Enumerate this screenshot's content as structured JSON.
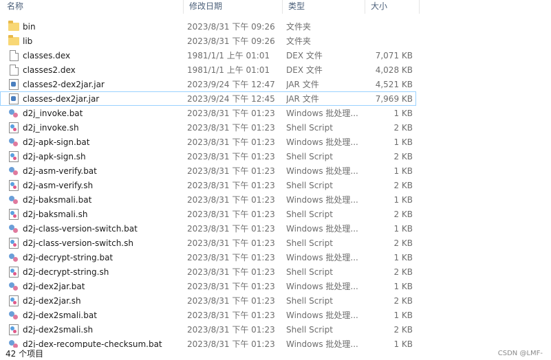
{
  "columns": {
    "name": "名称",
    "date": "修改日期",
    "type": "类型",
    "size": "大小"
  },
  "files": [
    {
      "icon": "folder",
      "name": "bin",
      "date": "2023/8/31 下午 09:26",
      "type": "文件夹",
      "size": ""
    },
    {
      "icon": "folder",
      "name": "lib",
      "date": "2023/8/31 下午 09:26",
      "type": "文件夹",
      "size": ""
    },
    {
      "icon": "file",
      "name": "classes.dex",
      "date": "1981/1/1 上午 01:01",
      "type": "DEX 文件",
      "size": "7,071 KB"
    },
    {
      "icon": "file",
      "name": "classes2.dex",
      "date": "1981/1/1 上午 01:01",
      "type": "DEX 文件",
      "size": "4,028 KB"
    },
    {
      "icon": "jar",
      "name": "classes2-dex2jar.jar",
      "date": "2023/9/24 下午 12:47",
      "type": "JAR 文件",
      "size": "4,521 KB"
    },
    {
      "icon": "jar",
      "name": "classes-dex2jar.jar",
      "date": "2023/9/24 下午 12:45",
      "type": "JAR 文件",
      "size": "7,969 KB",
      "selected": true
    },
    {
      "icon": "gear",
      "name": "d2j_invoke.bat",
      "date": "2023/8/31 下午 01:23",
      "type": "Windows 批处理...",
      "size": "1 KB"
    },
    {
      "icon": "script",
      "name": "d2j_invoke.sh",
      "date": "2023/8/31 下午 01:23",
      "type": "Shell Script",
      "size": "2 KB"
    },
    {
      "icon": "gear",
      "name": "d2j-apk-sign.bat",
      "date": "2023/8/31 下午 01:23",
      "type": "Windows 批处理...",
      "size": "1 KB"
    },
    {
      "icon": "script",
      "name": "d2j-apk-sign.sh",
      "date": "2023/8/31 下午 01:23",
      "type": "Shell Script",
      "size": "2 KB"
    },
    {
      "icon": "gear",
      "name": "d2j-asm-verify.bat",
      "date": "2023/8/31 下午 01:23",
      "type": "Windows 批处理...",
      "size": "1 KB"
    },
    {
      "icon": "script",
      "name": "d2j-asm-verify.sh",
      "date": "2023/8/31 下午 01:23",
      "type": "Shell Script",
      "size": "2 KB"
    },
    {
      "icon": "gear",
      "name": "d2j-baksmali.bat",
      "date": "2023/8/31 下午 01:23",
      "type": "Windows 批处理...",
      "size": "1 KB"
    },
    {
      "icon": "script",
      "name": "d2j-baksmali.sh",
      "date": "2023/8/31 下午 01:23",
      "type": "Shell Script",
      "size": "2 KB"
    },
    {
      "icon": "gear",
      "name": "d2j-class-version-switch.bat",
      "date": "2023/8/31 下午 01:23",
      "type": "Windows 批处理...",
      "size": "1 KB"
    },
    {
      "icon": "script",
      "name": "d2j-class-version-switch.sh",
      "date": "2023/8/31 下午 01:23",
      "type": "Shell Script",
      "size": "2 KB"
    },
    {
      "icon": "gear",
      "name": "d2j-decrypt-string.bat",
      "date": "2023/8/31 下午 01:23",
      "type": "Windows 批处理...",
      "size": "1 KB"
    },
    {
      "icon": "script",
      "name": "d2j-decrypt-string.sh",
      "date": "2023/8/31 下午 01:23",
      "type": "Shell Script",
      "size": "2 KB"
    },
    {
      "icon": "gear",
      "name": "d2j-dex2jar.bat",
      "date": "2023/8/31 下午 01:23",
      "type": "Windows 批处理...",
      "size": "1 KB"
    },
    {
      "icon": "script",
      "name": "d2j-dex2jar.sh",
      "date": "2023/8/31 下午 01:23",
      "type": "Shell Script",
      "size": "2 KB"
    },
    {
      "icon": "gear",
      "name": "d2j-dex2smali.bat",
      "date": "2023/8/31 下午 01:23",
      "type": "Windows 批处理...",
      "size": "1 KB"
    },
    {
      "icon": "script",
      "name": "d2j-dex2smali.sh",
      "date": "2023/8/31 下午 01:23",
      "type": "Shell Script",
      "size": "2 KB"
    },
    {
      "icon": "gear",
      "name": "d2j-dex-recompute-checksum.bat",
      "date": "2023/8/31 下午 01:23",
      "type": "Windows 批处理...",
      "size": "1 KB"
    }
  ],
  "status": {
    "item_count": "42 个项目"
  },
  "watermark": "CSDN @LMF-"
}
